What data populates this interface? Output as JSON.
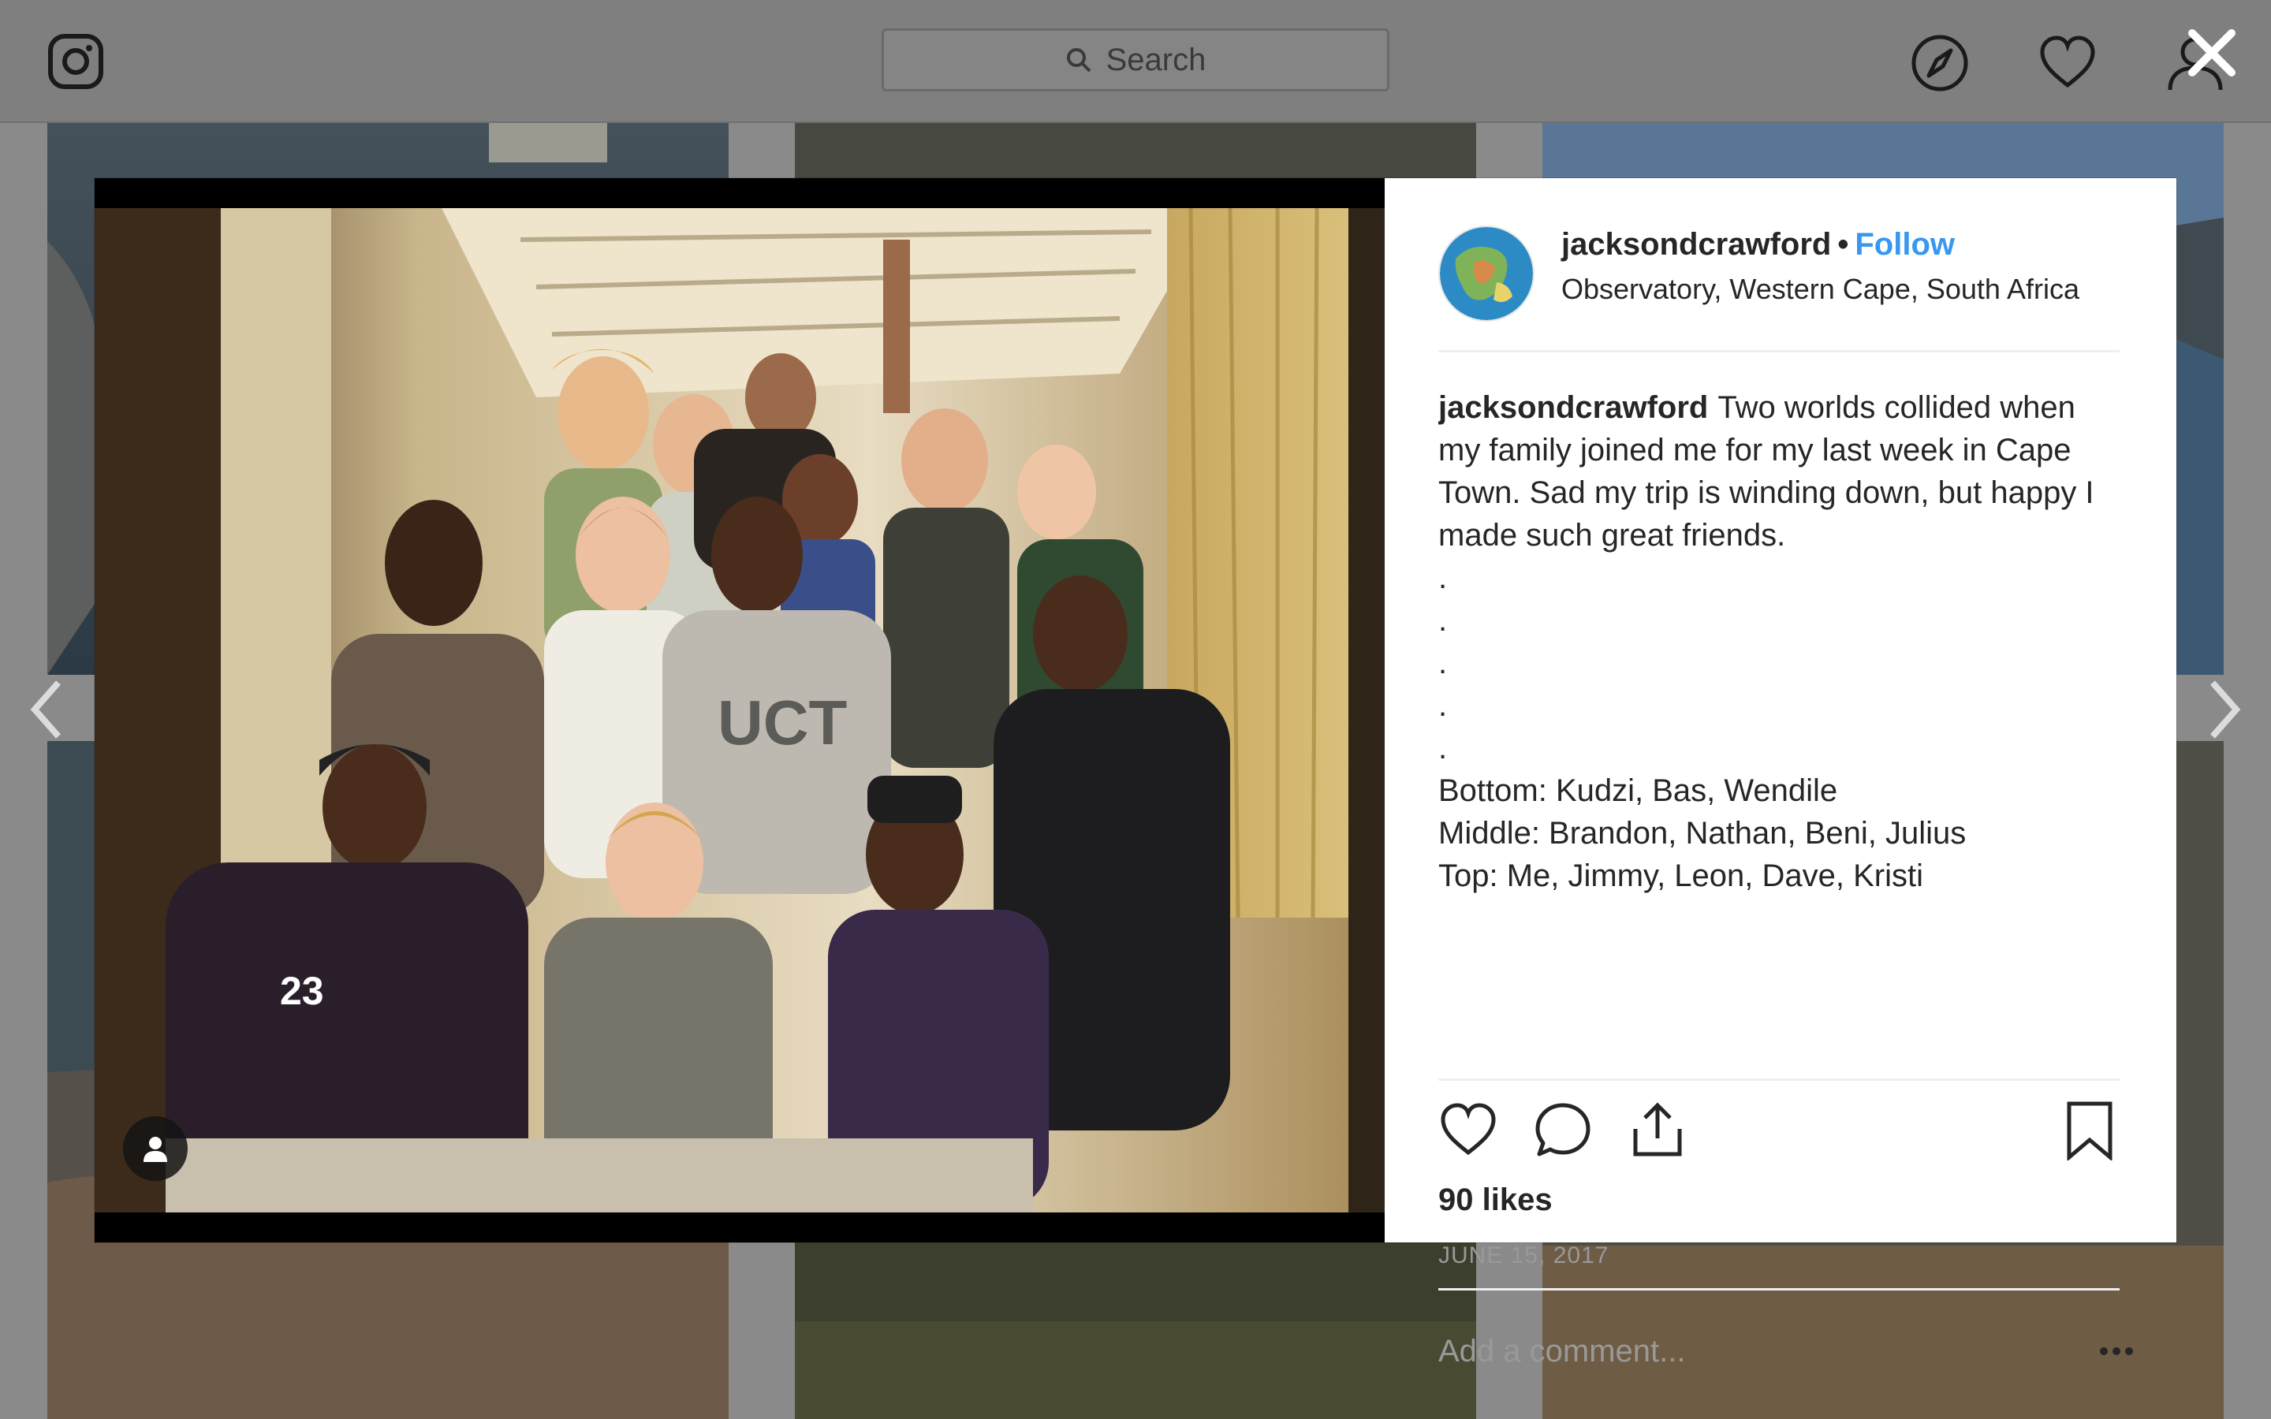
{
  "topbar": {
    "search_placeholder": "Search",
    "icons": [
      "instagram-icon",
      "search-icon",
      "explore-icon",
      "heart-icon",
      "profile-icon",
      "close-icon"
    ]
  },
  "post": {
    "username": "jacksondcrawford",
    "separator": "•",
    "follow_label": "Follow",
    "location": "Observatory, Western Cape, South Africa",
    "caption_user": "jacksondcrawford",
    "caption_lines": [
      "Two worlds collided when",
      "my family joined me for my last week in Cape",
      "Town. Sad my trip is winding down, but happy I",
      "made such great friends.",
      ".",
      ".",
      ".",
      ".",
      ".",
      "Bottom: Kudzi, Bas, Wendile",
      "Middle: Brandon, Nathan, Beni, Julius",
      "Top: Me, Jimmy, Leon, Dave, Kristi"
    ],
    "likes": "90 likes",
    "date": "JUNE 15, 2017",
    "comment_placeholder": "Add a comment..."
  },
  "colors": {
    "link": "#3897f0",
    "text": "#262626",
    "muted": "#999999",
    "overlay": "#8a8a8a"
  }
}
